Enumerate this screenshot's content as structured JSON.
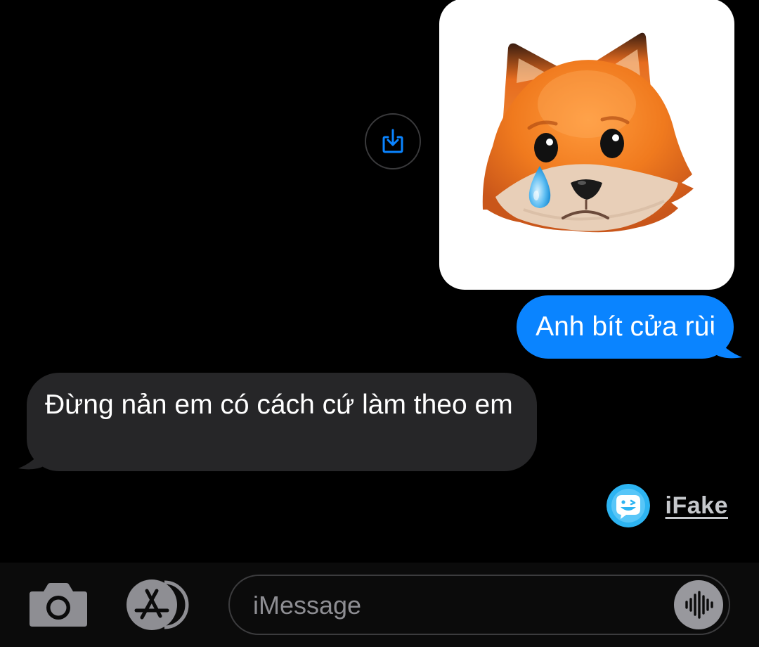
{
  "conversation": {
    "messages": [
      {
        "direction": "sent",
        "kind": "animoji",
        "animoji": "crying-fox"
      },
      {
        "direction": "sent",
        "kind": "text",
        "text": "Anh bít cửa rùi"
      },
      {
        "direction": "received",
        "kind": "text",
        "text": "Đừng nản em có cách cứ làm theo em"
      }
    ]
  },
  "watermark": {
    "icon": "smiling-face-logo",
    "text": "iFake"
  },
  "input_bar": {
    "camera_icon": "camera-icon",
    "apps_icon": "app-store-icon",
    "placeholder": "iMessage",
    "voice_icon": "waveform-icon"
  },
  "colors": {
    "background": "#000000",
    "sent_bubble": "#0A84FF",
    "received_bubble": "#262628",
    "input_bar": "#0B0B0B",
    "accent": "#0A84FF"
  }
}
